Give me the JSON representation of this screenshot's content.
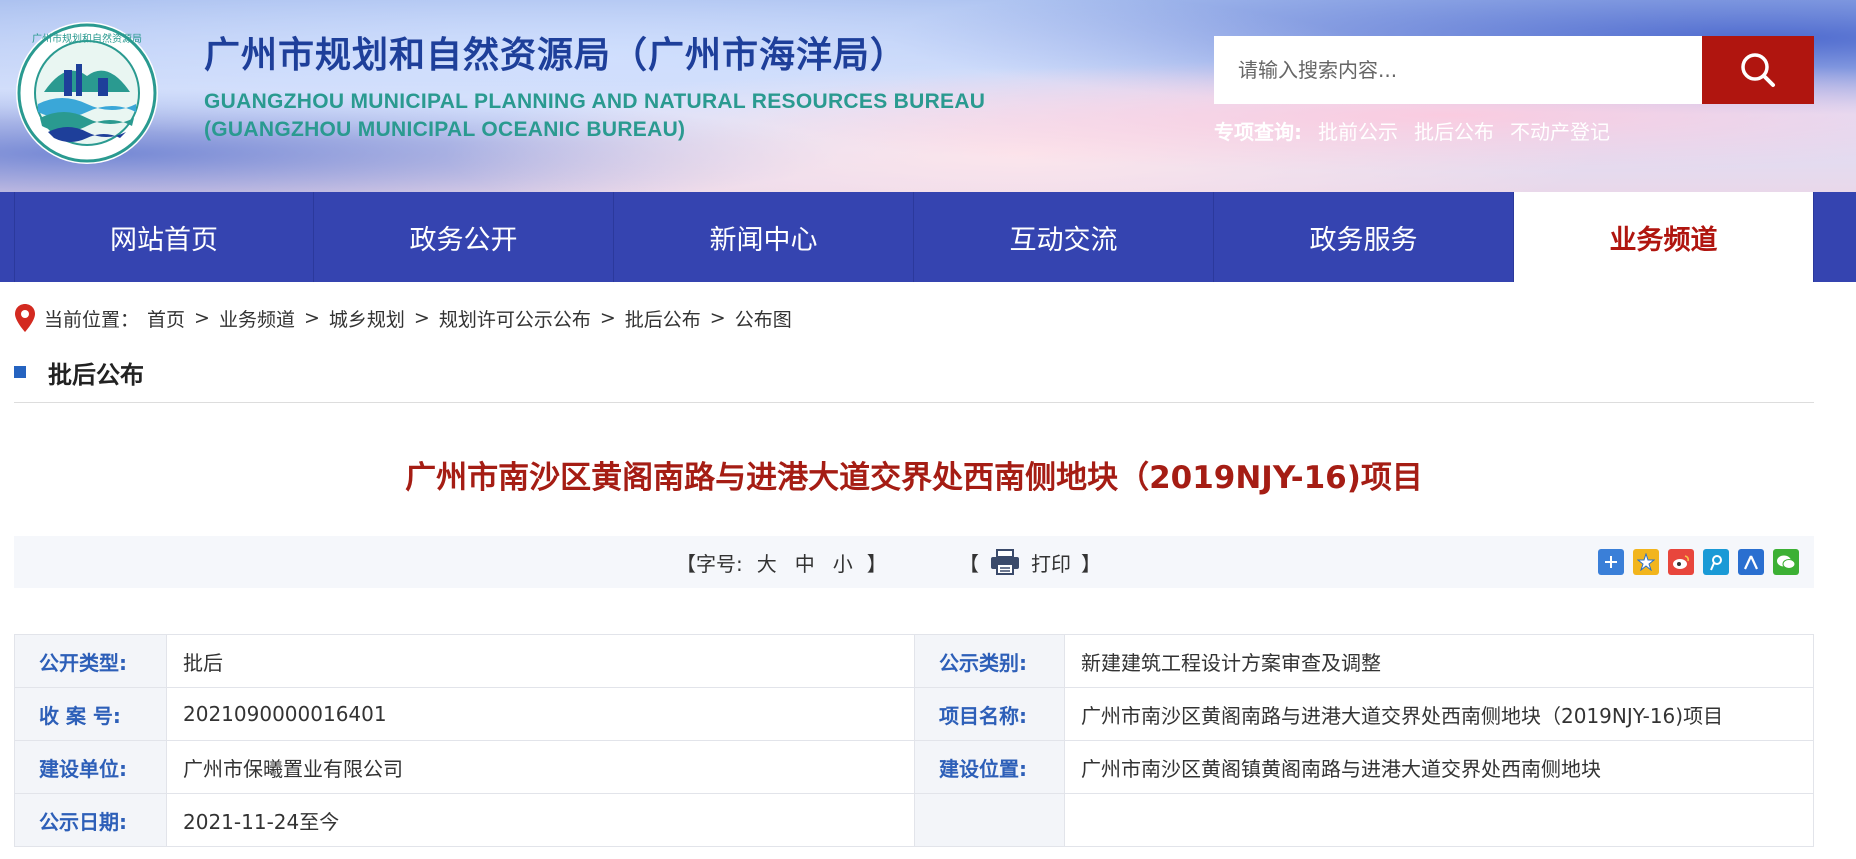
{
  "header": {
    "title": "广州市规划和自然资源局（广州市海洋局）",
    "title_en_line1": "GUANGZHOU MUNICIPAL PLANNING AND NATURAL RESOURCES BUREAU",
    "title_en_line2": "(GUANGZHOU MUNICIPAL OCEANIC BUREAU)",
    "logo_text": "广州市规划和自然资源局",
    "search_placeholder": "请输入搜索内容...",
    "quick_label": "专项查询:",
    "quick_links": [
      "批前公示",
      "批后公布",
      "不动产登记"
    ]
  },
  "nav": {
    "items": [
      {
        "label": "网站首页"
      },
      {
        "label": "政务公开"
      },
      {
        "label": "新闻中心"
      },
      {
        "label": "互动交流"
      },
      {
        "label": "政务服务"
      },
      {
        "label": "业务频道"
      }
    ],
    "active_index": 5
  },
  "breadcrumb": {
    "prefix": "当前位置：",
    "items": [
      "首页",
      "业务频道",
      "城乡规划",
      "规划许可公示公布",
      "批后公布",
      "公布图"
    ],
    "separator": ">"
  },
  "section": {
    "title": "批后公布"
  },
  "article": {
    "title": "广州市南沙区黄阁南路与进港大道交界处西南侧地块（2019NJY-16)项目"
  },
  "toolbar": {
    "fontsize_open": "【字号:",
    "fontsize_options": [
      "大",
      "中",
      "小"
    ],
    "fontsize_close": "】",
    "print_open": "【",
    "print_label": "打印",
    "print_close": "】",
    "share_icons": [
      "more-share-icon",
      "qzone-icon",
      "weibo-icon",
      "tencent-weibo-icon",
      "renren-icon",
      "wechat-icon"
    ]
  },
  "info": {
    "rows": [
      {
        "k1": "公开类型:",
        "v1": "批后",
        "k2": "公示类别:",
        "v2": "新建建筑工程设计方案审查及调整"
      },
      {
        "k1": "收 案 号:",
        "v1": "2021090000016401",
        "k2": "项目名称:",
        "v2": "广州市南沙区黄阁南路与进港大道交界处西南侧地块（2019NJY-16)项目"
      },
      {
        "k1": "建设单位:",
        "v1": "广州市保曦置业有限公司",
        "k2": "建设位置:",
        "v2": "广州市南沙区黄阁镇黄阁南路与进港大道交界处西南侧地块"
      },
      {
        "k1": "公示日期:",
        "v1": "2021-11-24至今",
        "k2": "",
        "v2": ""
      }
    ]
  },
  "colors": {
    "nav_bg": "#3544b0",
    "accent_red": "#b0150f",
    "title_red": "#a51d14",
    "label_blue": "#2d5fb8"
  }
}
